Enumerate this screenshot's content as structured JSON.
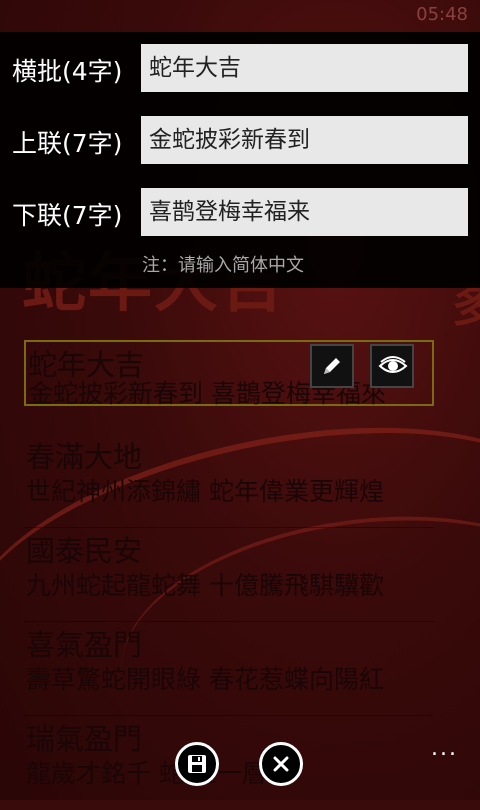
{
  "status": {
    "time": "05:48"
  },
  "background": {
    "title_main": "蛇年大吉",
    "title_side": "多"
  },
  "form": {
    "fields": [
      {
        "label": "横批(4字)",
        "value": "蛇年大吉"
      },
      {
        "label": "上联(7字)",
        "value": "金蛇披彩新春到"
      },
      {
        "label": "下联(7字)",
        "value": "喜鹊登梅幸福来"
      }
    ],
    "note": "注：请输入简体中文"
  },
  "list": {
    "items": [
      {
        "title": "蛇年大吉",
        "subtitle": "金蛇披彩新春到 喜鵲登梅幸福來"
      },
      {
        "title": "春滿大地",
        "subtitle": "世紀神州添錦繡 蛇年偉業更輝煌"
      },
      {
        "title": "國泰民安",
        "subtitle": "九州蛇起龍蛇舞 十億騰飛騏驥歡"
      },
      {
        "title": "喜氣盈門",
        "subtitle": "壽草驚蛇開眼綠 春花惹蝶向陽紅"
      },
      {
        "title": "瑞氣盈門",
        "subtitle": "龍歲才銘千 蛇 上一層樓"
      }
    ]
  },
  "appbar": {
    "more": "..."
  },
  "colors": {
    "accent": "#7a6a10",
    "background": "#3a0b0b"
  }
}
